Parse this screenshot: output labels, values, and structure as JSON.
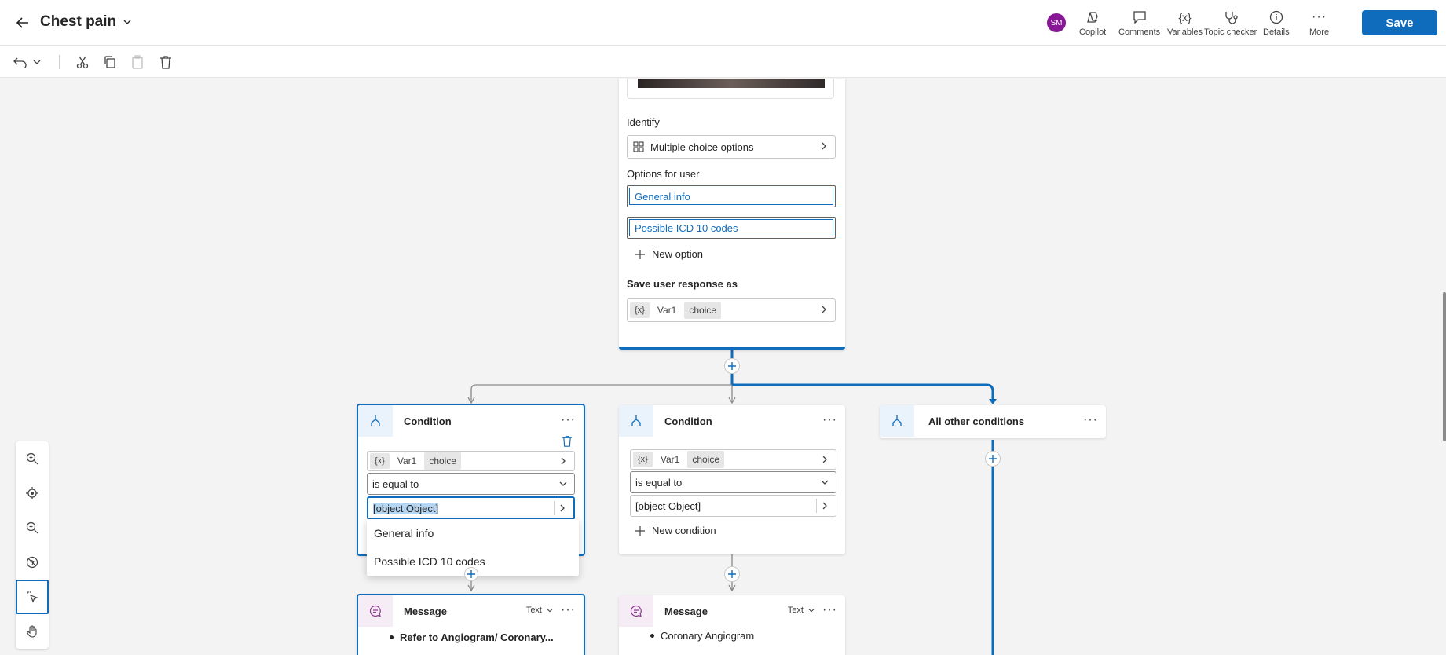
{
  "header": {
    "title": "Chest pain",
    "avatar_initials": "SM",
    "tools": [
      {
        "label": "Copilot",
        "icon": "copilot-icon"
      },
      {
        "label": "Comments",
        "icon": "comment-icon"
      },
      {
        "label": "Variables",
        "icon": "variables-icon"
      },
      {
        "label": "Topic checker",
        "icon": "stethoscope-icon"
      },
      {
        "label": "Details",
        "icon": "info-icon"
      },
      {
        "label": "More",
        "icon": "more-icon"
      }
    ],
    "save_label": "Save"
  },
  "colors": {
    "accent": "#0f6cbd",
    "avatar": "#881798"
  },
  "question_node": {
    "identify_label": "Identify",
    "identify_value": "Multiple choice options",
    "options_label": "Options for user",
    "options": [
      "General info",
      "Possible ICD 10 codes"
    ],
    "new_option_label": "New option",
    "save_response_label": "Save user response as",
    "var_badge": "{x}",
    "var_name": "Var1",
    "var_type": "choice"
  },
  "conditions": [
    {
      "title": "Condition",
      "var_badge": "{x}",
      "var_name": "Var1",
      "var_type": "choice",
      "operator": "is equal to",
      "value": "[object Object]"
    },
    {
      "title": "Condition",
      "var_badge": "{x}",
      "var_name": "Var1",
      "var_type": "choice",
      "operator": "is equal to",
      "value": "[object Object]",
      "new_condition_label": "New condition"
    },
    {
      "title": "All other conditions"
    }
  ],
  "dropdown": {
    "options": [
      "General info",
      "Possible ICD 10 codes"
    ]
  },
  "messages": [
    {
      "title": "Message",
      "type_label": "Text",
      "preview": "Refer to Angiogram/ Coronary..."
    },
    {
      "title": "Message",
      "type_label": "Text",
      "preview": "Coronary Angiogram"
    }
  ]
}
